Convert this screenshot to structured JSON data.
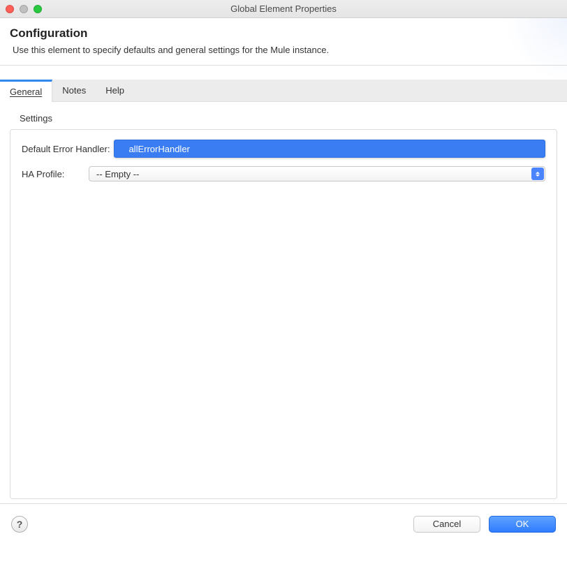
{
  "window": {
    "title": "Global Element Properties"
  },
  "header": {
    "title": "Configuration",
    "subtitle": "Use this element to specify defaults and general settings for the Mule instance."
  },
  "tabs": {
    "general": "General",
    "notes": "Notes",
    "help": "Help"
  },
  "settings": {
    "section_label": "Settings",
    "default_error_handler_label": "Default Error Handler:",
    "default_error_handler_value": "allErrorHandler",
    "ha_profile_label": "HA Profile:",
    "ha_profile_value": "-- Empty --"
  },
  "footer": {
    "help_glyph": "?",
    "cancel": "Cancel",
    "ok": "OK"
  }
}
